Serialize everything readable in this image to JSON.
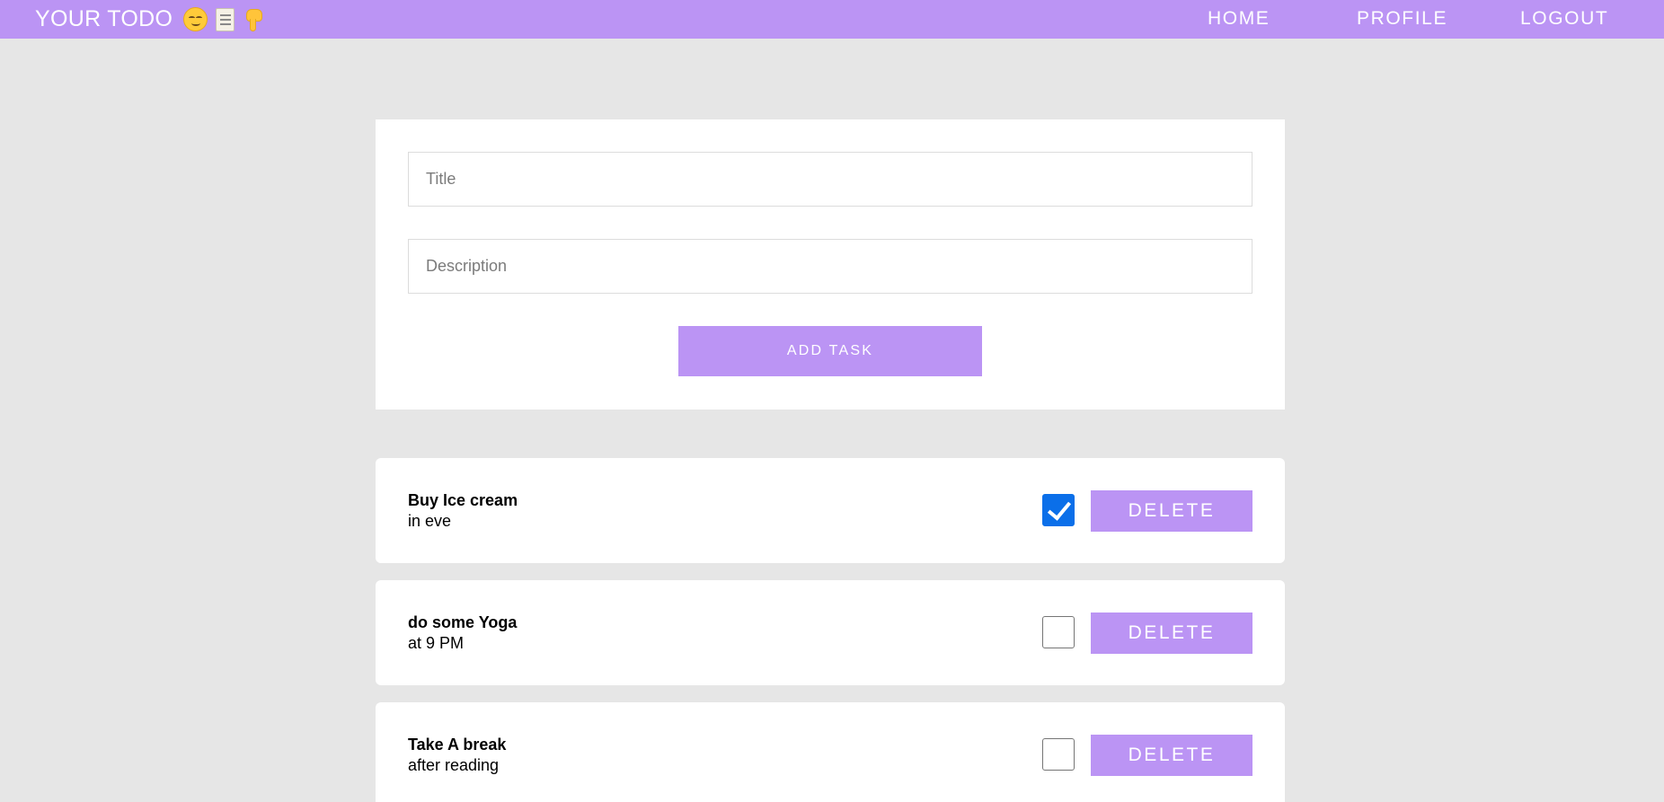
{
  "navbar": {
    "brand": "YOUR TODO",
    "brand_icons": [
      "smiling-face-icon",
      "memo-icon",
      "pointing-down-hand-icon"
    ],
    "links": [
      {
        "label": "HOME"
      },
      {
        "label": "PROFILE"
      },
      {
        "label": "LOGOUT"
      }
    ]
  },
  "form": {
    "title_placeholder": "Title",
    "description_placeholder": "Description",
    "submit_label": "ADD TASK"
  },
  "tasks": [
    {
      "title": "Buy Ice cream",
      "description": "in eve",
      "completed": true,
      "delete_label": "DELETE"
    },
    {
      "title": "do some Yoga",
      "description": "at 9 PM",
      "completed": false,
      "delete_label": "DELETE"
    },
    {
      "title": "Take A break",
      "description": "after reading",
      "completed": false,
      "delete_label": "DELETE"
    }
  ],
  "colors": {
    "accent": "#bb94f4",
    "background": "#e6e6e6",
    "card": "#ffffff",
    "checkbox_checked": "#0b6fe9"
  }
}
